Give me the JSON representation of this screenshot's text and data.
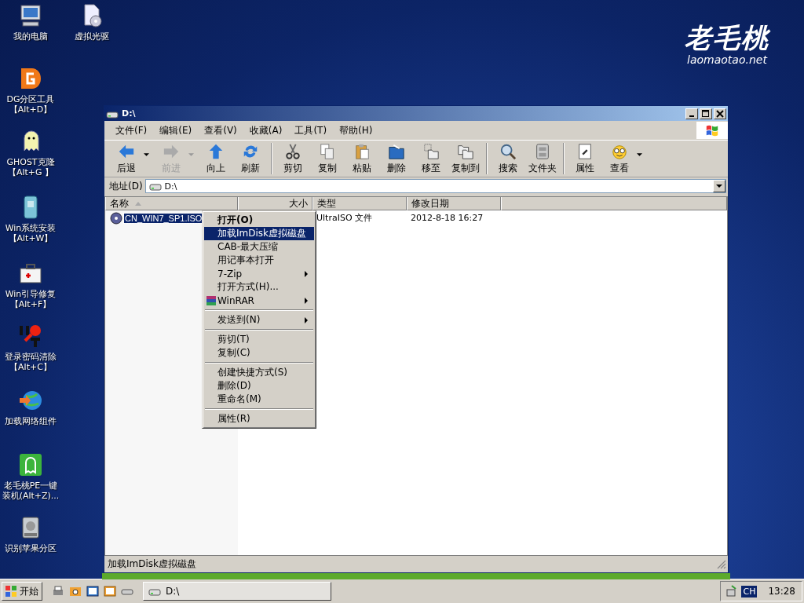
{
  "desktop": {
    "logo": {
      "title": "老毛桃",
      "site": "laomaotao.net"
    },
    "icons": [
      {
        "kind": "computer",
        "name": "我的电脑"
      },
      {
        "kind": "cdrom",
        "name": "虚拟光驱"
      },
      {
        "kind": "dg",
        "name": "DG分区工具",
        "shortcut": "【Alt+D】"
      },
      {
        "kind": "ghost",
        "name": "GHOST克隆",
        "shortcut": "【Alt+G 】"
      },
      {
        "kind": "install",
        "name": "Win系统安装",
        "shortcut": "【Alt+W】"
      },
      {
        "kind": "repair",
        "name": "Win引导修复",
        "shortcut": "【Alt+F】"
      },
      {
        "kind": "key",
        "name": "登录密码清除",
        "shortcut": "【Alt+C】"
      },
      {
        "kind": "network",
        "name": "加载网络组件"
      },
      {
        "kind": "pe",
        "name": "老毛桃PE一键装机(Alt+Z)..."
      },
      {
        "kind": "disk",
        "name": "识别苹果分区"
      }
    ]
  },
  "window": {
    "title": "D:\\",
    "menu": [
      "文件(F)",
      "编辑(E)",
      "查看(V)",
      "收藏(A)",
      "工具(T)",
      "帮助(H)"
    ],
    "toolbar": [
      [
        {
          "kind": "back",
          "label": "后退",
          "dropdown": true,
          "disabled": false
        },
        {
          "kind": "forward",
          "label": "前进",
          "dropdown": true,
          "disabled": true
        },
        {
          "kind": "up",
          "label": "向上",
          "dropdown": false,
          "disabled": false
        },
        {
          "kind": "refresh",
          "label": "刷新",
          "dropdown": false,
          "disabled": false
        }
      ],
      [
        {
          "kind": "cut",
          "label": "剪切",
          "dropdown": false,
          "disabled": false
        },
        {
          "kind": "copy",
          "label": "复制",
          "dropdown": false,
          "disabled": false
        },
        {
          "kind": "paste",
          "label": "粘贴",
          "dropdown": false,
          "disabled": false
        },
        {
          "kind": "delete",
          "label": "删除",
          "dropdown": false,
          "disabled": false
        },
        {
          "kind": "move",
          "label": "移至",
          "dropdown": false,
          "disabled": false
        },
        {
          "kind": "copyto",
          "label": "复制到",
          "dropdown": false,
          "disabled": false
        }
      ],
      [
        {
          "kind": "search",
          "label": "搜索",
          "dropdown": false,
          "disabled": false
        },
        {
          "kind": "folders",
          "label": "文件夹",
          "dropdown": false,
          "disabled": false
        }
      ],
      [
        {
          "kind": "properties",
          "label": "属性",
          "dropdown": false,
          "disabled": false
        },
        {
          "kind": "views",
          "label": "查看",
          "dropdown": true,
          "disabled": false
        }
      ]
    ],
    "address": {
      "label": "地址(D)",
      "value": "D:\\"
    },
    "columns": [
      {
        "label": "名称"
      },
      {
        "label": "大小"
      },
      {
        "label": "类型"
      },
      {
        "label": "修改日期"
      }
    ],
    "rows": [
      {
        "name": "CN_WIN7_SP1.ISO",
        "type": "UltraISO 文件",
        "modified": "2012-8-18 16:27",
        "selected": true
      }
    ],
    "context_menu": [
      {
        "kind": "item",
        "label": "打开(O)",
        "bold": true,
        "selected": false,
        "submenu": false
      },
      {
        "kind": "item",
        "label": "加载ImDisk虚拟磁盘",
        "bold": false,
        "selected": true,
        "submenu": false
      },
      {
        "kind": "item",
        "label": "CAB-最大压缩",
        "bold": false,
        "selected": false,
        "submenu": false
      },
      {
        "kind": "item",
        "label": "用记事本打开",
        "bold": false,
        "selected": false,
        "submenu": false
      },
      {
        "kind": "item",
        "label": "7-Zip",
        "bold": false,
        "selected": false,
        "submenu": true
      },
      {
        "kind": "item",
        "label": "打开方式(H)...",
        "bold": false,
        "selected": false,
        "submenu": false
      },
      {
        "kind": "icon_item",
        "label": "WinRAR",
        "bold": false,
        "selected": false,
        "submenu": true
      },
      {
        "kind": "separator"
      },
      {
        "kind": "item",
        "label": "发送到(N)",
        "bold": false,
        "selected": false,
        "submenu": true
      },
      {
        "kind": "separator"
      },
      {
        "kind": "item",
        "label": "剪切(T)",
        "bold": false,
        "selected": false,
        "submenu": false
      },
      {
        "kind": "item",
        "label": "复制(C)",
        "bold": false,
        "selected": false,
        "submenu": false
      },
      {
        "kind": "separator"
      },
      {
        "kind": "item",
        "label": "创建快捷方式(S)",
        "bold": false,
        "selected": false,
        "submenu": false
      },
      {
        "kind": "item",
        "label": "删除(D)",
        "bold": false,
        "selected": false,
        "submenu": false
      },
      {
        "kind": "item",
        "label": "重命名(M)",
        "bold": false,
        "selected": false,
        "submenu": false
      },
      {
        "kind": "separator"
      },
      {
        "kind": "item",
        "label": "属性(R)",
        "bold": false,
        "selected": false,
        "submenu": false
      }
    ],
    "status": "加载ImDisk虚拟磁盘"
  },
  "taskbar": {
    "start": "开始",
    "quick_launch": [
      {
        "kind": "printer"
      },
      {
        "kind": "search-folder"
      },
      {
        "kind": "screen"
      },
      {
        "kind": "screen2"
      },
      {
        "kind": "drive"
      }
    ],
    "tasks": [
      {
        "label": "D:\\",
        "selected": false
      }
    ],
    "tray": {
      "language": "CH",
      "clock": "13:28"
    }
  }
}
